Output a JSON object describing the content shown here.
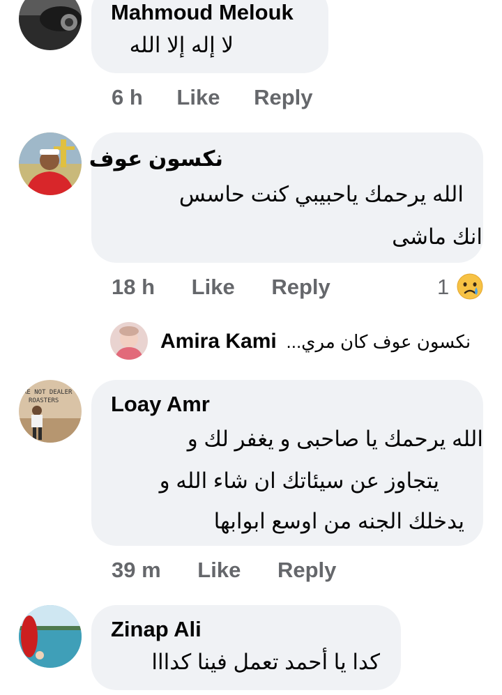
{
  "comments": [
    {
      "author": "Mahmoud Melouk",
      "lines": [
        "لا إله إلا الله"
      ],
      "time": "6 h",
      "like_label": "Like",
      "reply_label": "Reply"
    },
    {
      "author": "نكسون عوف",
      "lines": [
        "الله يرحمك ياحبيبي كنت حاسس",
        "انك ماشى"
      ],
      "time": "18 h",
      "like_label": "Like",
      "reply_label": "Reply",
      "reaction_count": "1",
      "reaction_icon": "crying-face-icon"
    },
    {
      "author": "Loay Amr",
      "lines": [
        "الله يرحمك يا صاحبى و يغفر لك و",
        "يتجاوز عن سيئاتك ان شاء الله و",
        "يدخلك الجنه من اوسع ابوابها"
      ],
      "time": "39 m",
      "like_label": "Like",
      "reply_label": "Reply"
    },
    {
      "author": "Zinap Ali",
      "lines": [
        "كدا يا أحمد تعمل فينا كدااا"
      ]
    }
  ],
  "reply_preview": {
    "author": "Amira Kami",
    "snippet": "نكسون عوف كان مري..."
  },
  "colors": {
    "bubble": "#f0f2f5",
    "meta_text": "#65676b",
    "primary_text": "#050505"
  }
}
